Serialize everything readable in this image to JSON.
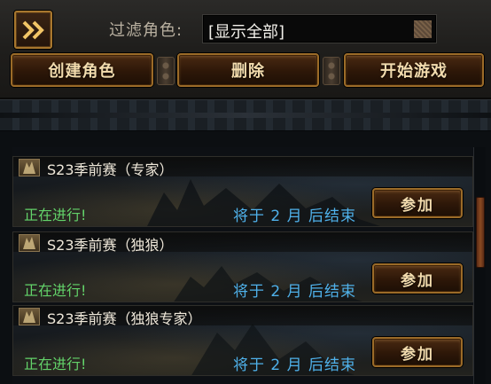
{
  "top_panel": {
    "filter_label": "过滤角色:",
    "filter_value": "[显示全部]",
    "buttons": {
      "create": "创建角色",
      "delete": "删除",
      "start": "开始游戏"
    }
  },
  "events": [
    {
      "title": "S23季前赛（专家）",
      "status": "正在进行!",
      "countdown": "将于 2 月 后结束",
      "join_label": "参加"
    },
    {
      "title": "S23季前赛（独狼）",
      "status": "正在进行!",
      "countdown": "将于 2 月 后结束",
      "join_label": "参加"
    },
    {
      "title": "S23季前赛（独狼专家）",
      "status": "正在进行!",
      "countdown": "将于 2 月 后结束",
      "join_label": "参加"
    }
  ],
  "colors": {
    "status_green": "#63d36a",
    "countdown_blue": "#4fb1ea",
    "button_gold": "#9b6b28"
  },
  "icons": {
    "collapse": "double-chevron-right-icon",
    "event": "event-banner-icon",
    "dropdown": "dropdown-icon"
  }
}
